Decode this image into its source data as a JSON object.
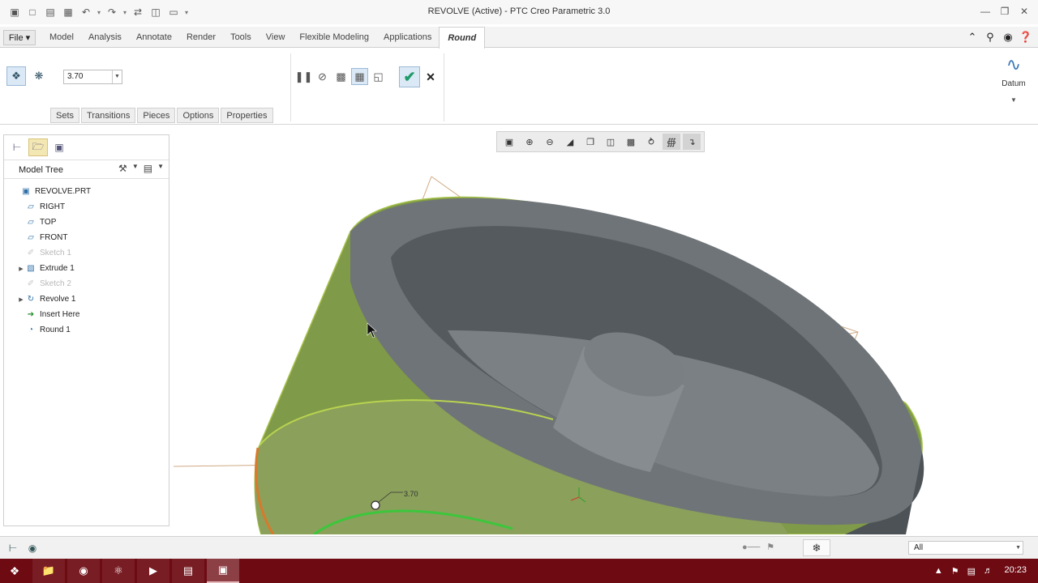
{
  "window": {
    "title": "REVOLVE (Active) - PTC Creo Parametric 3.0"
  },
  "ribbon_tabs": {
    "file": "File ▾",
    "tabs": [
      "Model",
      "Analysis",
      "Annotate",
      "Render",
      "Tools",
      "View",
      "Flexible Modeling",
      "Applications",
      "Round"
    ],
    "active": "Round"
  },
  "round_tool": {
    "radius_value": "3.70",
    "panels": [
      "Sets",
      "Transitions",
      "Pieces",
      "Options",
      "Properties"
    ],
    "datum_label": "Datum"
  },
  "model_tree": {
    "title": "Model Tree",
    "items": [
      {
        "label": "REVOLVE.PRT",
        "icon": "part-icon",
        "expander": "",
        "dimmed": false,
        "indent": 0
      },
      {
        "label": "RIGHT",
        "icon": "datum-plane-icon",
        "expander": "",
        "dimmed": false,
        "indent": 1
      },
      {
        "label": "TOP",
        "icon": "datum-plane-icon",
        "expander": "",
        "dimmed": false,
        "indent": 1
      },
      {
        "label": "FRONT",
        "icon": "datum-plane-icon",
        "expander": "",
        "dimmed": false,
        "indent": 1
      },
      {
        "label": "Sketch 1",
        "icon": "sketch-icon",
        "expander": "",
        "dimmed": true,
        "indent": 1
      },
      {
        "label": "Extrude 1",
        "icon": "extrude-icon",
        "expander": "▶",
        "dimmed": false,
        "indent": 1
      },
      {
        "label": "Sketch 2",
        "icon": "sketch-icon",
        "expander": "",
        "dimmed": true,
        "indent": 1
      },
      {
        "label": "Revolve 1",
        "icon": "revolve-icon",
        "expander": "▶",
        "dimmed": false,
        "indent": 1
      },
      {
        "label": "Insert Here",
        "icon": "insert-here-icon",
        "expander": "",
        "dimmed": false,
        "indent": 1
      },
      {
        "label": "Round 1",
        "icon": "round-icon",
        "expander": "",
        "dimmed": false,
        "indent": 1
      }
    ]
  },
  "viewport": {
    "dimension_label": "3.70"
  },
  "status_bar": {
    "filter_value": "All"
  },
  "taskbar": {
    "clock": "20:23"
  },
  "colors": {
    "selection_green": "#7e9a44",
    "model_gray": "#6d7276",
    "taskbar": "#6d0a12",
    "accent_blue": "#3a78b8"
  }
}
